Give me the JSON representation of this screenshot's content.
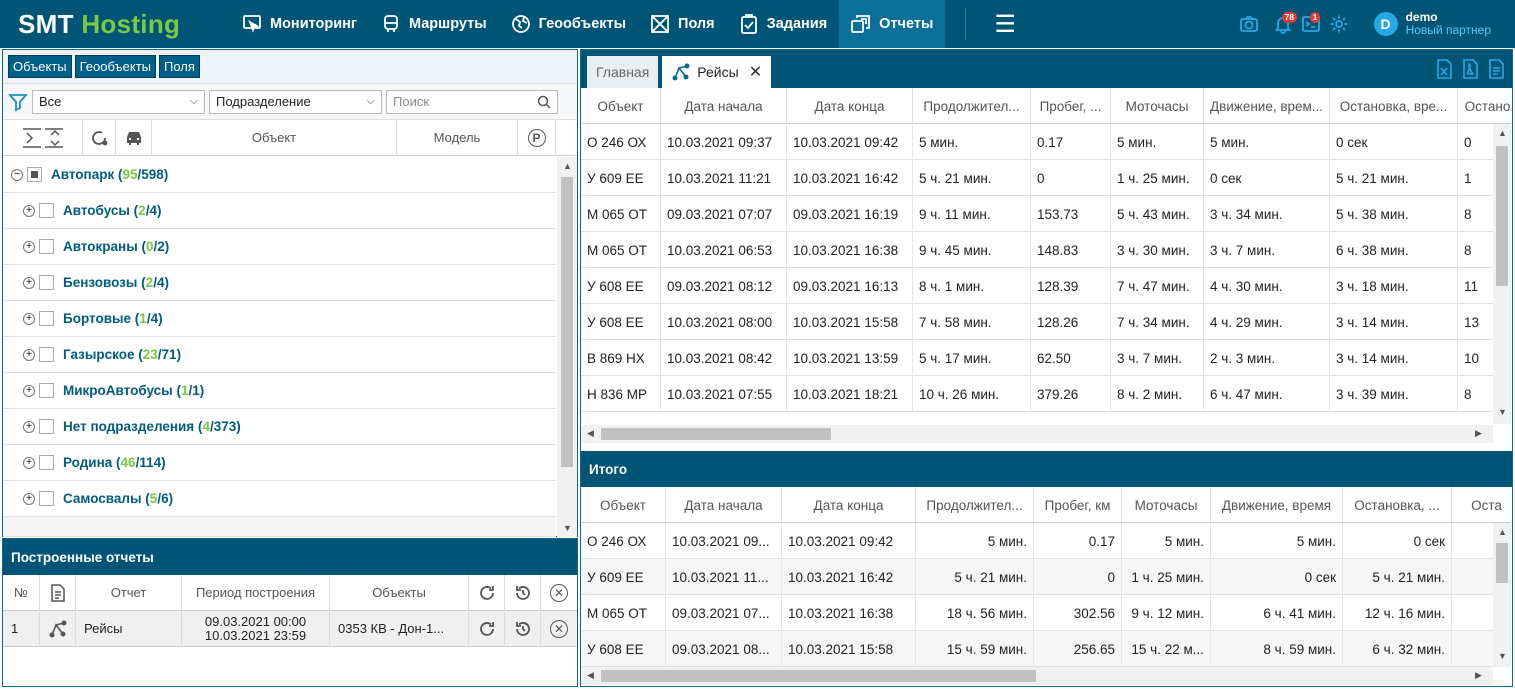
{
  "brand": {
    "part1": "SMT",
    "part2": "Hosting"
  },
  "nav": [
    {
      "label": "Мониторинг",
      "icon": "monitor-icon"
    },
    {
      "label": "Маршруты",
      "icon": "bus-icon"
    },
    {
      "label": "Геообъекты",
      "icon": "globe-icon"
    },
    {
      "label": "Поля",
      "icon": "field-icon"
    },
    {
      "label": "Задания",
      "icon": "clipboard-icon"
    },
    {
      "label": "Отчеты",
      "icon": "reports-icon",
      "active": true
    }
  ],
  "topbar": {
    "notifications_count": "78",
    "messages_count": "1"
  },
  "user": {
    "initial": "D",
    "name": "demo",
    "partner": "Новый партнер"
  },
  "left": {
    "tabs": [
      "Объекты",
      "Геообъекты",
      "Поля"
    ],
    "filter_all": "Все",
    "filter_division": "Подразделение",
    "search_placeholder": "Поиск",
    "col_object": "Объект",
    "col_model": "Модель",
    "tree_root": {
      "name": "Автопарк",
      "active": "95",
      "total": "598"
    },
    "tree": [
      {
        "name": "Автобусы",
        "active": "2",
        "total": "4"
      },
      {
        "name": "Автокраны",
        "active": "0",
        "total": "2"
      },
      {
        "name": "Бензовозы",
        "active": "2",
        "total": "4"
      },
      {
        "name": "Бортовые",
        "active": "1",
        "total": "4"
      },
      {
        "name": "Газырское",
        "active": "23",
        "total": "71"
      },
      {
        "name": "МикроАвтобусы",
        "active": "1",
        "total": "1"
      },
      {
        "name": "Нет подразделения",
        "active": "4",
        "total": "373"
      },
      {
        "name": "Родина",
        "active": "46",
        "total": "114"
      },
      {
        "name": "Самосвалы",
        "active": "5",
        "total": "6"
      }
    ]
  },
  "built": {
    "title": "Построенные отчеты",
    "col_num": "№",
    "col_report": "Отчет",
    "col_period": "Период построения",
    "col_objects": "Объекты",
    "row": {
      "num": "1",
      "report": "Рейсы",
      "period_from": "09.03.2021 00:00",
      "period_to": "10.03.2021 23:59",
      "objects": "0353 КВ - Дон-1..."
    }
  },
  "right": {
    "tab_main": "Главная",
    "tab_trips": "Рейсы",
    "columns": [
      "Объект",
      "Дата начала",
      "Дата конца",
      "Продолжител...",
      "Пробег, ...",
      "Моточасы",
      "Движение, врем...",
      "Остановка, вре...",
      "Остано"
    ],
    "rows": [
      [
        "О 246 ОХ",
        "10.03.2021 09:37",
        "10.03.2021 09:42",
        "5 мин.",
        "0.17",
        "5 мин.",
        "5 мин.",
        "0 сек",
        "0"
      ],
      [
        "У 609 ЕЕ",
        "10.03.2021 11:21",
        "10.03.2021 16:42",
        "5 ч. 21 мин.",
        "0",
        "1 ч. 25 мин.",
        "0 сек",
        "5 ч. 21 мин.",
        "1"
      ],
      [
        "М 065 ОТ",
        "09.03.2021 07:07",
        "09.03.2021 16:19",
        "9 ч. 11 мин.",
        "153.73",
        "5 ч. 43 мин.",
        "3 ч. 34 мин.",
        "5 ч. 38 мин.",
        "8"
      ],
      [
        "М 065 ОТ",
        "10.03.2021 06:53",
        "10.03.2021 16:38",
        "9 ч. 45 мин.",
        "148.83",
        "3 ч. 30 мин.",
        "3 ч. 7 мин.",
        "6 ч. 38 мин.",
        "8"
      ],
      [
        "У 608 ЕЕ",
        "09.03.2021 08:12",
        "09.03.2021 16:13",
        "8 ч. 1 мин.",
        "128.39",
        "7 ч. 47 мин.",
        "4 ч. 30 мин.",
        "3 ч. 18 мин.",
        "11"
      ],
      [
        "У 608 ЕЕ",
        "10.03.2021 08:00",
        "10.03.2021 15:58",
        "7 ч. 58 мин.",
        "128.26",
        "7 ч. 34 мин.",
        "4 ч. 29 мин.",
        "3 ч. 14 мин.",
        "13"
      ],
      [
        "В 869 НХ",
        "10.03.2021 08:42",
        "10.03.2021 13:59",
        "5 ч. 17 мин.",
        "62.50",
        "3 ч. 7 мин.",
        "2 ч. 3 мин.",
        "3 ч. 14 мин.",
        "10"
      ],
      [
        "Н 836 МР",
        "10.03.2021 07:55",
        "10.03.2021 18:21",
        "10 ч. 26 мин.",
        "379.26",
        "8 ч. 2 мин.",
        "6 ч. 47 мин.",
        "3 ч. 39 мин.",
        "8"
      ]
    ],
    "itogo_title": "Итого",
    "itogo_columns": [
      "Объект",
      "Дата начала",
      "Дата конца",
      "Продолжител...",
      "Пробег, км",
      "Моточасы",
      "Движение, время",
      "Остановка, ...",
      "Оста"
    ],
    "itogo_rows": [
      [
        "О 246 ОХ",
        "10.03.2021 09...",
        "10.03.2021 09:42",
        "5 мин.",
        "0.17",
        "5 мин.",
        "5 мин.",
        "0 сек",
        ""
      ],
      [
        "У 609 ЕЕ",
        "10.03.2021 11...",
        "10.03.2021 16:42",
        "5 ч. 21 мин.",
        "0",
        "1 ч. 25 мин.",
        "0 сек",
        "5 ч. 21 мин.",
        ""
      ],
      [
        "М 065 ОТ",
        "09.03.2021 07...",
        "10.03.2021 16:38",
        "18 ч. 56 мин.",
        "302.56",
        "9 ч. 12 мин.",
        "6 ч. 41 мин.",
        "12 ч. 16 мин.",
        ""
      ],
      [
        "У 608 ЕЕ",
        "09.03.2021 08...",
        "10.03.2021 15:58",
        "15 ч. 59 мин.",
        "256.65",
        "15 ч. 22 м...",
        "8 ч. 59 мин.",
        "6 ч. 32 мин.",
        ""
      ]
    ]
  }
}
